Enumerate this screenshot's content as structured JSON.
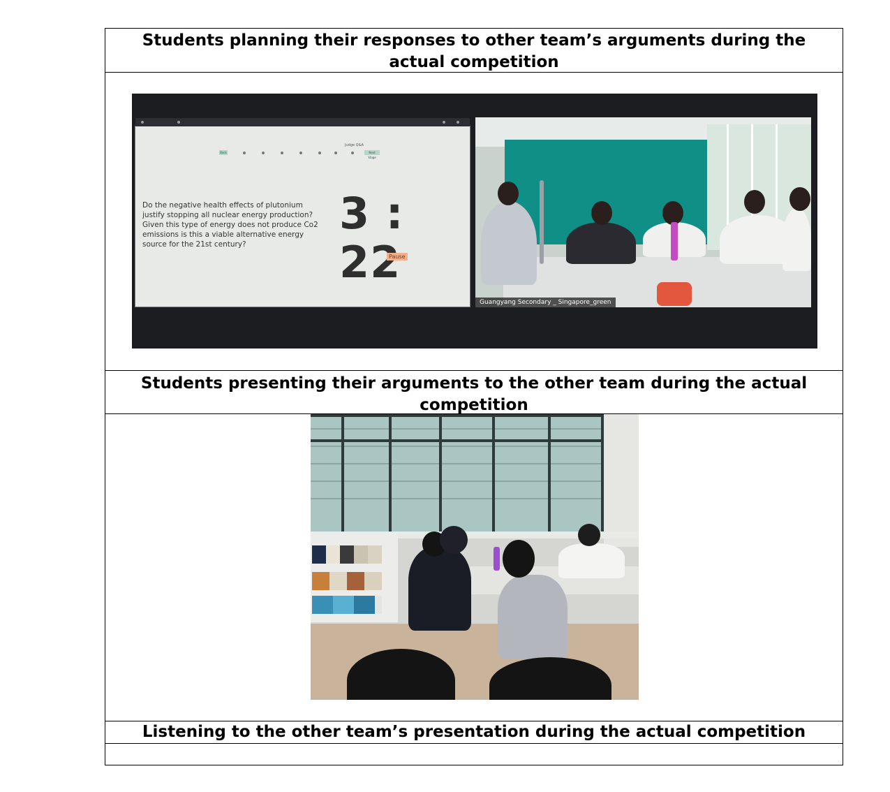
{
  "captions": {
    "row1": "Students planning their responses to other team’s arguments during the actual competition",
    "row2": "Students presenting their arguments to the other team during the actual competition",
    "row3": "Listening to the other team’s presentation during the actual competition"
  },
  "photo1": {
    "stage_title": "Judge Q&A",
    "stage_left": "Back",
    "stage_right": "Next Stage",
    "question": "Do the negative health effects of plutonium justify stopping all nuclear energy production? Given this type of energy does not produce Co2 emissions is this a viable alternative energy source for the 21st century?",
    "timer": "3 : 22",
    "pause_label": "Pause",
    "video_caption": "Guangyang Secondary _ Singapore_green"
  },
  "colors": {
    "border": "#000000",
    "teal_wall": "#0f8f86",
    "pause_button": "#f4b08c"
  }
}
